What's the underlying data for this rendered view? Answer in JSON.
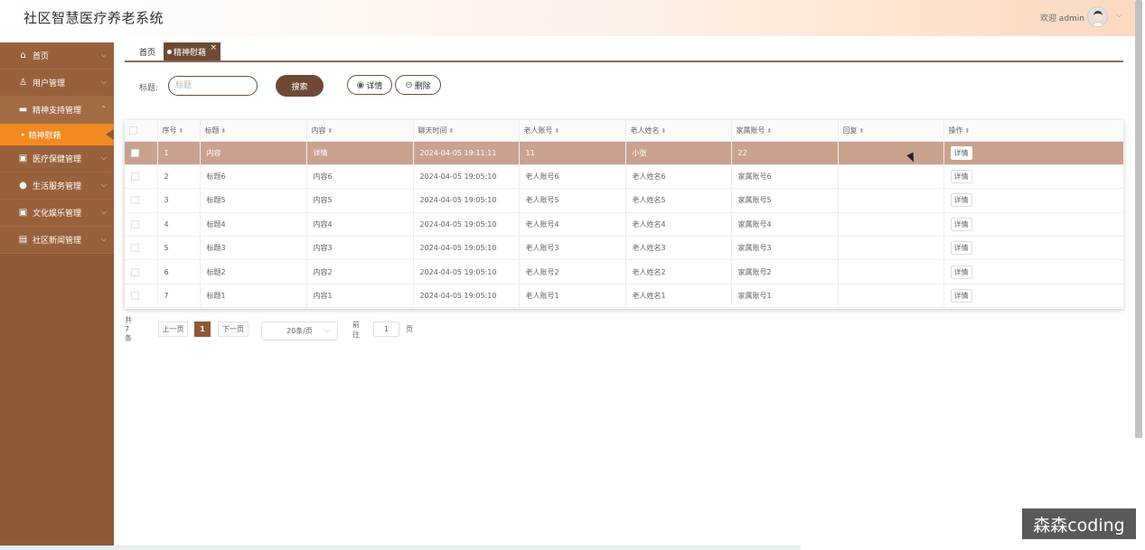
{
  "header": {
    "app_title": "社区智慧医疗养老系统",
    "welcome": "欢迎 admin"
  },
  "sidebar": {
    "items": [
      {
        "label": "首页",
        "icon": "home-icon"
      },
      {
        "label": "用户管理",
        "icon": "user-icon"
      },
      {
        "label": "精神支持管理",
        "icon": "support-icon",
        "expanded": true
      },
      {
        "label": "医疗保健管理",
        "icon": "medical-icon"
      },
      {
        "label": "生活服务管理",
        "icon": "service-icon"
      },
      {
        "label": "文化娱乐管理",
        "icon": "culture-icon"
      },
      {
        "label": "社区新闻管理",
        "icon": "news-icon"
      }
    ],
    "active_sub": "精神慰藉"
  },
  "tabs": {
    "home": "首页",
    "current": "精神慰藉",
    "close": "×"
  },
  "search": {
    "label": "标题:",
    "placeholder": "标题",
    "button": "搜索"
  },
  "toolbar": {
    "detail": "详情",
    "delete": "删除"
  },
  "table": {
    "columns": [
      "序号",
      "标题",
      "内容",
      "聊天时间",
      "老人账号",
      "老人姓名",
      "家属账号",
      "回复",
      "操作"
    ],
    "action_label": "详情",
    "rows": [
      {
        "index": "1",
        "title": "内容",
        "content": "详情",
        "time": "2024-04-05 19:11:11",
        "elder_account": "11",
        "elder_name": "小张",
        "family_account": "22",
        "reply": ""
      },
      {
        "index": "2",
        "title": "标题6",
        "content": "内容6",
        "time": "2024-04-05 19:05:10",
        "elder_account": "老人账号6",
        "elder_name": "老人姓名6",
        "family_account": "家属账号6",
        "reply": ""
      },
      {
        "index": "3",
        "title": "标题5",
        "content": "内容5",
        "time": "2024-04-05 19:05:10",
        "elder_account": "老人账号5",
        "elder_name": "老人姓名5",
        "family_account": "家属账号5",
        "reply": ""
      },
      {
        "index": "4",
        "title": "标题4",
        "content": "内容4",
        "time": "2024-04-05 19:05:10",
        "elder_account": "老人账号4",
        "elder_name": "老人姓名4",
        "family_account": "家属账号4",
        "reply": ""
      },
      {
        "index": "5",
        "title": "标题3",
        "content": "内容3",
        "time": "2024-04-05 19:05:10",
        "elder_account": "老人账号3",
        "elder_name": "老人姓名3",
        "family_account": "家属账号3",
        "reply": ""
      },
      {
        "index": "6",
        "title": "标题2",
        "content": "内容2",
        "time": "2024-04-05 19:05:10",
        "elder_account": "老人账号2",
        "elder_name": "老人姓名2",
        "family_account": "家属账号2",
        "reply": ""
      },
      {
        "index": "7",
        "title": "标题1",
        "content": "内容1",
        "time": "2024-04-05 19:05:10",
        "elder_account": "老人账号1",
        "elder_name": "老人姓名1",
        "family_account": "家属账号1",
        "reply": ""
      }
    ]
  },
  "pagination": {
    "total": "共 7 条",
    "prev": "上一页",
    "page": "1",
    "next": "下一页",
    "page_size": "20条/页",
    "goto": "前往",
    "jump_value": "1",
    "unit": "页"
  },
  "watermark": "森森coding",
  "colors": {
    "sidebar_bg": "#8e5936",
    "active_sub_bg": "#f28a22",
    "primary": "#6e4a36",
    "row_highlight": "#c9a28d"
  }
}
